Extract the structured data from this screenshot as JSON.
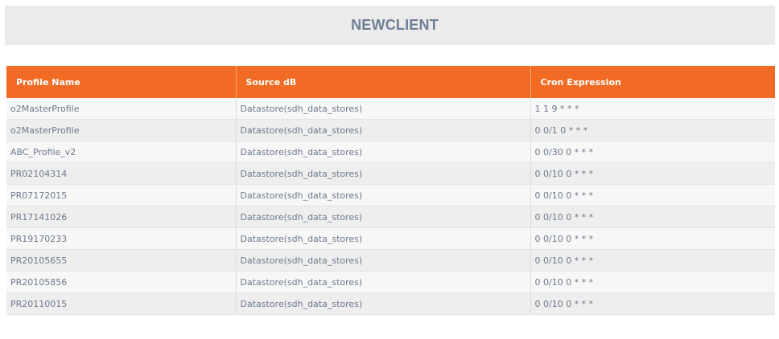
{
  "page": {
    "title": "NEWCLIENT"
  },
  "table": {
    "headers": [
      "Profile Name",
      "Source dB",
      "Cron Expression"
    ],
    "rows": [
      [
        "o2MasterProfile",
        "Datastore(sdh_data_stores)",
        "1 1 9 * * *"
      ],
      [
        "o2MasterProfile",
        "Datastore(sdh_data_stores)",
        "0 0/1 0 * * *"
      ],
      [
        "ABC_Profile_v2",
        "Datastore(sdh_data_stores)",
        "0 0/30 0 * * *"
      ],
      [
        "PR02104314",
        "Datastore(sdh_data_stores)",
        "0 0/10 0 * * *"
      ],
      [
        "PR07172015",
        "Datastore(sdh_data_stores)",
        "0 0/10 0 * * *"
      ],
      [
        "PR17141026",
        "Datastore(sdh_data_stores)",
        "0 0/10 0 * * *"
      ],
      [
        "PR19170233",
        "Datastore(sdh_data_stores)",
        "0 0/10 0 * * *"
      ],
      [
        "PR20105655",
        "Datastore(sdh_data_stores)",
        "0 0/10 0 * * *"
      ],
      [
        "PR20105856",
        "Datastore(sdh_data_stores)",
        "0 0/10 0 * * *"
      ],
      [
        "PR20110015",
        "Datastore(sdh_data_stores)",
        "0 0/10 0 * * *"
      ]
    ]
  },
  "colors": {
    "header_bg": "#f26b24",
    "header_text": "#ffffff",
    "title_text": "#6e7f96",
    "title_bg": "#ebebeb",
    "cell_text": "#6c7a8c"
  }
}
